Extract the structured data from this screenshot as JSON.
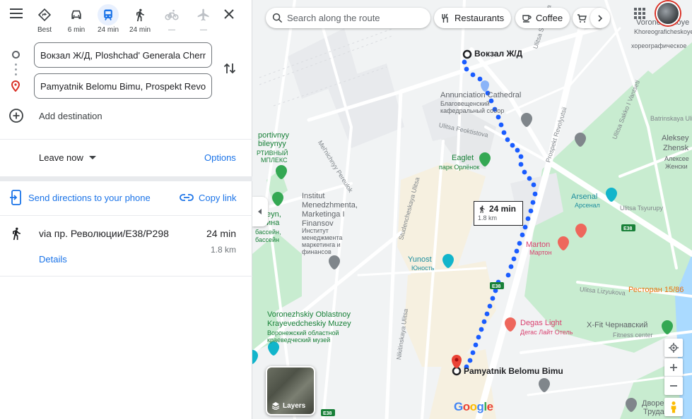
{
  "modes": [
    {
      "name": "best",
      "label": "Best",
      "active": false,
      "disabled": false
    },
    {
      "name": "driving",
      "label": "6 min",
      "active": false,
      "disabled": false
    },
    {
      "name": "transit",
      "label": "24 min",
      "active": true,
      "disabled": false
    },
    {
      "name": "walking",
      "label": "24 min",
      "active": false,
      "disabled": false
    },
    {
      "name": "cycling",
      "label": "—",
      "active": false,
      "disabled": true
    },
    {
      "name": "flight",
      "label": "—",
      "active": false,
      "disabled": true
    }
  ],
  "directions": {
    "origin": "Вокзал Ж/Д, Ploshchad' Generala Chernyakhovskogo",
    "destination": "Pamyatnik Belomu Bimu, Prospekt Revolyutsii",
    "add_destination": "Add destination",
    "leave_now": "Leave now",
    "options": "Options",
    "send_to_phone": "Send directions to your phone",
    "copy_link": "Copy link"
  },
  "route": {
    "via": "via пр. Революции/E38/P298",
    "time": "24 min",
    "distance": "1.8 km",
    "details": "Details"
  },
  "map": {
    "search_placeholder": "Search along the route",
    "chips": [
      "Restaurants",
      "Coffee"
    ],
    "route_label_time": "24 min",
    "route_label_distance": "1.8 km",
    "origin_label": "Вокзал Ж/Д",
    "destination_label": "Pamyatnik Belomu Bimu",
    "layers_label": "Layers",
    "google_logo": "Google",
    "places": {
      "annunciation_en": "Annunciation Cathedral",
      "annunciation_ru": "Благовещенский кафедральный собор",
      "eaglet_en": "Eaglet",
      "eaglet_ru": "парк Орлёнок",
      "institute_en": "Institut Menedzhmenta, Marketinga I Finansov",
      "institute_ru": "Институт менеджмента маркетинга и финансов",
      "yunost_en": "Yunost",
      "yunost_ru": "Юность",
      "arsenal_en": "Arsenal",
      "arsenal_ru": "Арсенал",
      "marton_en": "Marton",
      "marton_ru": "Мартон",
      "degas_en": "Degas Light",
      "degas_ru": "Дегас Лайт Отель",
      "museum_en": "Voronezhskiy Oblastnoy Krayevedcheskiy Muzey",
      "museum_ru": "Воронежский областной краеведческий музей",
      "xfit_en": "X-Fit Чернавский",
      "xfit_ru": "Fitness center",
      "restoran": "Ресторан 15/86",
      "sport_frag1": "portivnyy",
      "sport_frag2": "bileynyy",
      "sport_frag3": "РТИВНЫЙ",
      "sport_frag4": "МПЛЕКС",
      "pool_frag1": "eyn,",
      "pool_frag2": "ина",
      "pool_frag3": "бассейн,",
      "pool_frag4": "бассейн",
      "choreo_frag1": "Voronezhskoye",
      "choreo_frag2": "Khoreograficheskoye",
      "choreo_frag3": "хореографическое",
      "alekseyev_frag1": "Batrinskaya Ulitsa",
      "alekseyev_frag2": "Aleksey",
      "alekseyev_frag3": "Zhensk",
      "alekseyev_frag4": "Алексее",
      "alekseyev_frag5": "Женски",
      "dvorets_frag1": "Дворе",
      "dvorets_frag2": "Труда"
    },
    "streets": {
      "sverdlova": "Ulitsa Sverdlova",
      "revolyutsii": "Prospekt Revolyutsii",
      "feoktistova": "Ulitsa Feoktistova",
      "melnichnyy": "Mel'nichnyy Pereulok",
      "studencheskaya": "Studencheskaya Ulitsa",
      "nikitinskaya": "Nikitinskaya Ulitsa",
      "tsyurupy": "Ulitsa Tsyurupy",
      "sakko": "Ulitsa Sakko I Vantseti",
      "lizyukova": "Ulitsa Lizyukova",
      "e38": "E38"
    }
  },
  "colors": {
    "route": "#1a5cff",
    "accent": "#1a73e8",
    "park": "#c8ecd0",
    "road": "#ffffff"
  }
}
